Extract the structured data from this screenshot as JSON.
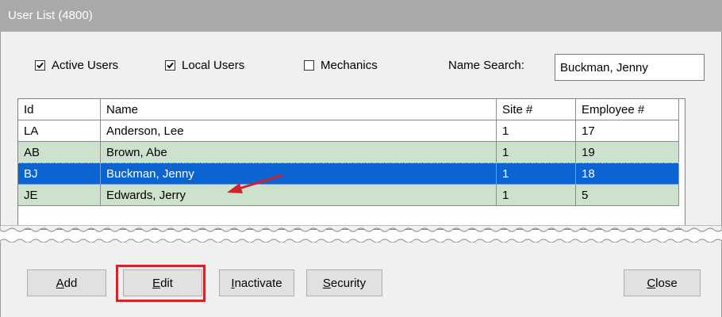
{
  "window": {
    "title": "User List (4800)"
  },
  "filters": {
    "active_users": {
      "label": "Active Users",
      "checked": true
    },
    "local_users": {
      "label": "Local Users",
      "checked": true
    },
    "mechanics": {
      "label": "Mechanics",
      "checked": false
    }
  },
  "search": {
    "label": "Name Search:",
    "value": "Buckman, Jenny"
  },
  "grid": {
    "columns": [
      "Id",
      "Name",
      "Site #",
      "Employee #"
    ],
    "rows": [
      {
        "id": "LA",
        "name": "Anderson, Lee",
        "site": "1",
        "employee": "17",
        "style": "white"
      },
      {
        "id": "AB",
        "name": "Brown, Abe",
        "site": "1",
        "employee": "19",
        "style": "green"
      },
      {
        "id": "BJ",
        "name": "Buckman, Jenny",
        "site": "1",
        "employee": "18",
        "style": "selected"
      },
      {
        "id": "JE",
        "name": "Edwards, Jerry",
        "site": "1",
        "employee": "5",
        "style": "green"
      }
    ]
  },
  "buttons": {
    "add": {
      "mnemonic": "A",
      "rest": "dd"
    },
    "edit": {
      "mnemonic": "E",
      "rest": "dit"
    },
    "inactivate": {
      "mnemonic": "I",
      "rest": "nactivate"
    },
    "security": {
      "mnemonic": "S",
      "rest": "ecurity"
    },
    "close": {
      "mnemonic": "C",
      "rest": "lose"
    }
  },
  "colors": {
    "selected_row": "#0a64d2",
    "alt_row": "#cce2cc",
    "callout": "#d2232a"
  }
}
